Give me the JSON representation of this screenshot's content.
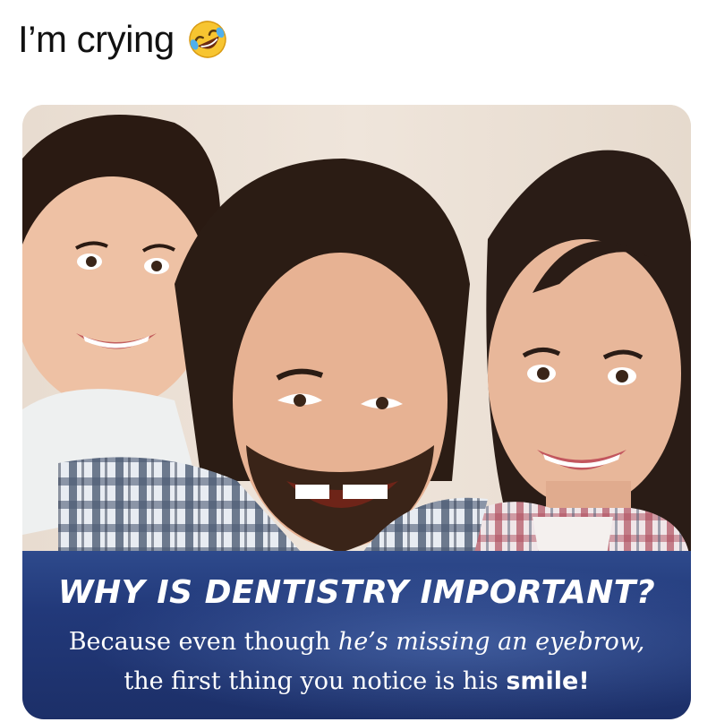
{
  "caption": {
    "text": "I’m crying",
    "emoji": "rolling-on-floor-laughing-emoji"
  },
  "image": {
    "description_icon": "family-photo",
    "banner": {
      "headline": "WHY IS DENTISTRY IMPORTANT?",
      "line1_a": "Because even though ",
      "line1_b": "he’s missing an eyebrow,",
      "line2_a": "the first thing you notice is his ",
      "line2_b": "smile!"
    }
  },
  "colors": {
    "banner": "#22397a",
    "text": "#111111"
  }
}
